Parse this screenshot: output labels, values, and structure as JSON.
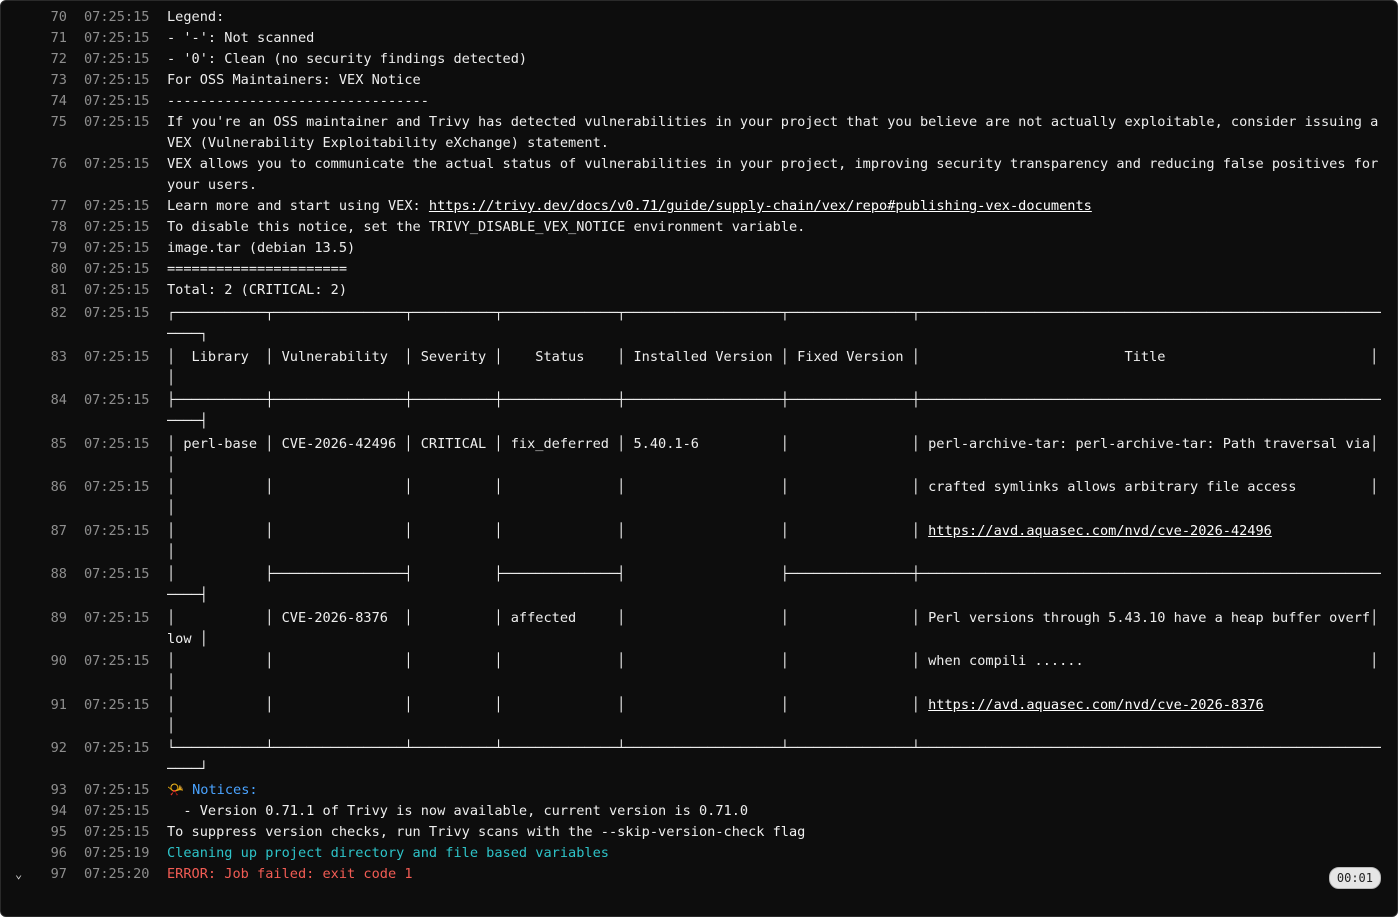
{
  "log": {
    "lines": [
      {
        "n": "70",
        "t": "07:25:15",
        "text": "Legend:"
      },
      {
        "n": "71",
        "t": "07:25:15",
        "text": "- '-': Not scanned"
      },
      {
        "n": "72",
        "t": "07:25:15",
        "text": "- '0': Clean (no security findings detected)"
      },
      {
        "n": "73",
        "t": "07:25:15",
        "text": "For OSS Maintainers: VEX Notice"
      },
      {
        "n": "74",
        "t": "07:25:15",
        "text": "--------------------------------"
      },
      {
        "n": "75",
        "t": "07:25:15",
        "text": "If you're an OSS maintainer and Trivy has detected vulnerabilities in your project that you believe are not actually exploitable, consider issuing a VEX (Vulnerability Exploitability eXchange) statement."
      },
      {
        "n": "76",
        "t": "07:25:15",
        "text": "VEX allows you to communicate the actual status of vulnerabilities in your project, improving security transparency and reducing false positives for your users."
      },
      {
        "n": "77",
        "t": "07:25:15",
        "text": "Learn more and start using VEX: ",
        "link": "https://trivy.dev/docs/v0.71/guide/supply-chain/vex/repo#publishing-vex-documents"
      },
      {
        "n": "78",
        "t": "07:25:15",
        "text": "To disable this notice, set the TRIVY_DISABLE_VEX_NOTICE environment variable."
      },
      {
        "n": "79",
        "t": "07:25:15",
        "text": "image.tar (debian 13.5)"
      },
      {
        "n": "80",
        "t": "07:25:15",
        "text": "======================"
      },
      {
        "n": "81",
        "t": "07:25:15",
        "text": "Total: 2 (CRITICAL: 2)"
      }
    ],
    "table_rows": [
      {
        "n": "82",
        "t": "07:25:15"
      },
      {
        "n": "83",
        "t": "07:25:15"
      },
      {
        "n": "84",
        "t": "07:25:15"
      },
      {
        "n": "85",
        "t": "07:25:15"
      },
      {
        "n": "86",
        "t": "07:25:15"
      },
      {
        "n": "87",
        "t": "07:25:15"
      },
      {
        "n": "88",
        "t": "07:25:15"
      },
      {
        "n": "89",
        "t": "07:25:15"
      },
      {
        "n": "90",
        "t": "07:25:15"
      },
      {
        "n": "91",
        "t": "07:25:15"
      },
      {
        "n": "92",
        "t": "07:25:15"
      }
    ],
    "table": {
      "headers": [
        "Library",
        "Vulnerability",
        "Severity",
        "Status",
        "Installed Version",
        "Fixed Version",
        "Title"
      ],
      "library": "perl-base",
      "vuln1": "CVE-2026-42496",
      "severity": "CRITICAL",
      "status1": "fix_deferred",
      "installed": "5.40.1-6",
      "title1a": "perl-archive-tar: perl-archive-tar: Path traversal via",
      "title1b": "crafted symlinks allows arbitrary file access",
      "title1c": "https://avd.aquasec.com/nvd/cve-2026-42496",
      "vuln2": "CVE-2026-8376",
      "status2": "affected",
      "title2a": "Perl versions through 5.43.10 have a heap buffer overf",
      "title2wrap": "low",
      "title2b": "when compili ......",
      "title2c": "https://avd.aquasec.com/nvd/cve-2026-8376"
    },
    "tail": [
      {
        "n": "93",
        "t": "07:25:15",
        "emoji": "📯",
        "text": " Notices:"
      },
      {
        "n": "94",
        "t": "07:25:15",
        "text": "  - Version 0.71.1 of Trivy is now available, current version is 0.71.0"
      },
      {
        "n": "95",
        "t": "07:25:15",
        "text": "To suppress version checks, run Trivy scans with the --skip-version-check flag"
      },
      {
        "n": "96",
        "t": "07:25:19",
        "text": "Cleaning up project directory and file based variables"
      },
      {
        "n": "97",
        "t": "07:25:20",
        "text": "ERROR: Job failed: exit code 1"
      }
    ],
    "duration": "00:01",
    "toggle_icon": "chevron-down-icon"
  }
}
